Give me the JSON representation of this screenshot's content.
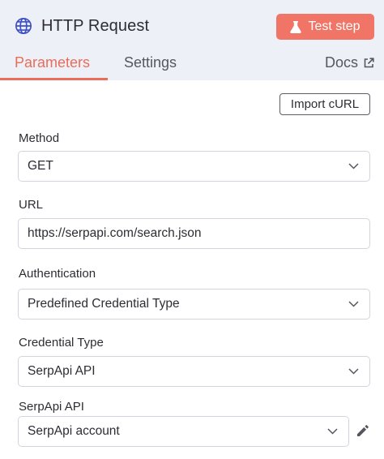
{
  "header": {
    "title": "HTTP Request",
    "title_icon": "globe-icon",
    "test_step_label": "Test step",
    "test_step_icon": "flask-icon",
    "accent_color": "#f07566"
  },
  "tabs": [
    {
      "label": "Parameters",
      "active": true
    },
    {
      "label": "Settings",
      "active": false
    }
  ],
  "docs": {
    "label": "Docs",
    "icon": "external-link-icon"
  },
  "import_curl_label": "Import cURL",
  "fields": {
    "method": {
      "label": "Method",
      "value": "GET"
    },
    "url": {
      "label": "URL",
      "value": "https://serpapi.com/search.json"
    },
    "authentication": {
      "label": "Authentication",
      "value": "Predefined Credential Type"
    },
    "credential_type": {
      "label": "Credential Type",
      "value": "SerpApi API"
    },
    "serpapi_api": {
      "label": "SerpApi API",
      "value": "SerpApi account",
      "edit_icon": "pencil-icon"
    }
  }
}
